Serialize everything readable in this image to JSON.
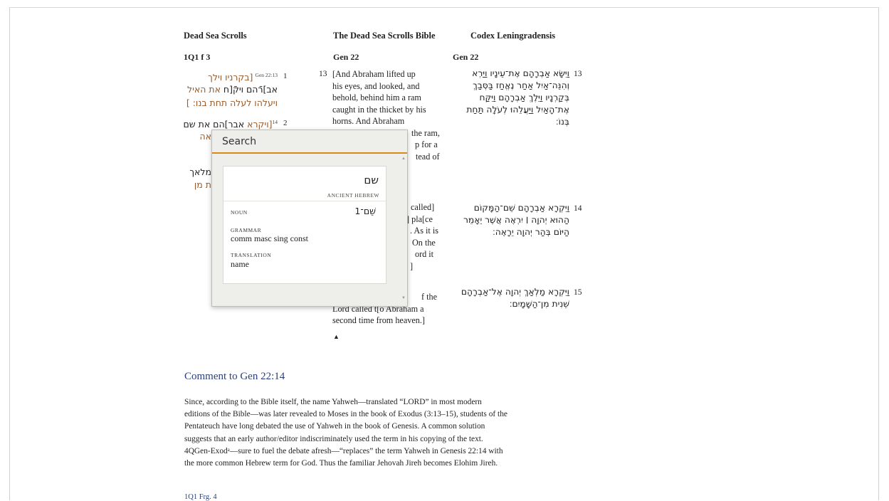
{
  "columns": {
    "dss": {
      "title": "Dead Sea Scrolls",
      "ref": "1Q1 f 3"
    },
    "dssb": {
      "title": "The Dead Sea Scrolls Bible",
      "ref": "Gen 22"
    },
    "leningrad": {
      "title": "Codex Leningradensis",
      "ref": "Gen 22"
    }
  },
  "dss_lines": {
    "l1_num": "1",
    "l1_sup": "Gen 22:13",
    "l1_text": "[בקרניו וילך",
    "l2_a": "אב]רֿהם ויקֿ[ח ",
    "l2_b": "את האיל",
    "l3": "ויעלהו לעלה תחת בנו: ]",
    "l4_num": "2",
    "l4_sup": "14",
    "l4_a": "[ויקרא ",
    "l4_b": "אבר]הם את שם",
    "l5": "אה",
    "l6": "מלאך",
    "l7": "ת מן"
  },
  "dssb_verses": {
    "v13_num": "13",
    "v13_lines": [
      "[And Abraham lifted up",
      "his eyes, and looked, and",
      "behold, behind him a ram",
      "caught in the thicket by his",
      "horns. And Abraham",
      "the ram,",
      "p for a",
      "tead of"
    ],
    "v14_lines": [
      "called]",
      "] pla[ce",
      ". As it is",
      "On the",
      "ord it",
      "]"
    ],
    "v15_lines": [
      "f the",
      "Lord called t[o Abraham a",
      "second time from heaven.]"
    ],
    "end_marker": "▲"
  },
  "leningrad_verses": {
    "v13_num": "13",
    "v13_lines": [
      "וַיִּשָּׂא אַבְרָהָם אֶת־עֵינָיו וַיַּרְא",
      "וְהִנֵּה־אַיִל אַחַר נֶאֱחַז בַּסְּבַךְ",
      "בְּקַרְנָיו וַיֵּלֶךְ אַבְרָהָם וַיִּקַּח",
      "אֶת־הָאַיִל וַיַּעֲלֵהוּ לְעֹלָה תַּחַת",
      "בְּנוֹ׃"
    ],
    "v14_num": "14",
    "v14_lines": [
      "וַיִּקְרָא אַבְרָהָם שֵׁם־הַמָּקוֹם",
      "הַהוּא יְהוָה ׀ יִרְאֶה אֲשֶׁר יֵאָמֵר",
      "הַיּוֹם בְּהַר יְהוָה יֵרָאֶה׃"
    ],
    "v15_num": "15",
    "v15_lines": [
      "וַיִּקְרָא מַלְאַךְ יְהוָה אֶל־אַבְרָהָם",
      "שֵׁנִית מִן־הַשָּׁמָיִם׃"
    ]
  },
  "comment": {
    "title": "Comment to Gen 22:14",
    "lines": [
      "Since, according to the Bible itself, the name Yahweh—translated “LORD” in most modern",
      "editions of the Bible—was later revealed to Moses in the book of Exodus (3:13–15), students of the",
      "Pentateuch have long debated the use of Yahweh in the book of Genesis. A common solution",
      "suggests that an early author/editor indiscriminately used the term in his copying of the text.",
      "4QGen-Exodᵃ—sure to fuel the debate afresh—“replaces” the term Yahweh in Genesis 22:14 with",
      "the more common Hebrew term for God. Thus the familiar Jehovah Jireh becomes Elohim Jireh."
    ],
    "next_ref": "1Q1 Frg. 4"
  },
  "popup": {
    "search_placeholder": "Search",
    "word": "שם",
    "language": "ANCIENT HEBREW",
    "part_of_speech": "NOUN",
    "lemma": "שֵׁם־1",
    "grammar_label": "GRAMMAR",
    "grammar_value": "comm masc sing const",
    "translation_label": "TRANSLATION",
    "translation_value": "name",
    "scroll_up": "▲",
    "scroll_down": "▼"
  }
}
